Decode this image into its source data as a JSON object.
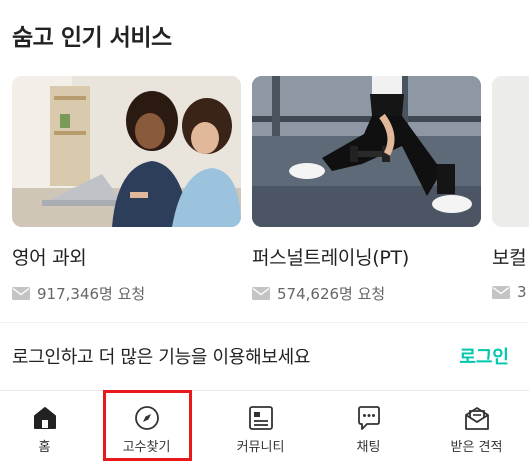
{
  "section": {
    "title": "숨고 인기 서비스"
  },
  "cards": [
    {
      "title": "영어 과외",
      "requests": "917,346명 요청",
      "image": "tutoring-photo"
    },
    {
      "title": "퍼스널트레이닝(PT)",
      "requests": "574,626명 요청",
      "image": "fitness-photo"
    },
    {
      "title": "보컬",
      "requests": "3",
      "image": "partial-photo"
    }
  ],
  "login_banner": {
    "text": "로그인하고 더 많은 기능을 이용해보세요",
    "link": "로그인"
  },
  "tabbar": {
    "items": [
      {
        "label": "홈",
        "icon": "home-icon"
      },
      {
        "label": "고수찾기",
        "icon": "compass-icon"
      },
      {
        "label": "커뮤니티",
        "icon": "community-icon"
      },
      {
        "label": "채팅",
        "icon": "chat-icon"
      },
      {
        "label": "받은 견적",
        "icon": "quote-icon"
      }
    ]
  },
  "colors": {
    "accent": "#00c7ae",
    "highlight": "#e8191b",
    "text": "#222222",
    "muted": "#666666"
  }
}
